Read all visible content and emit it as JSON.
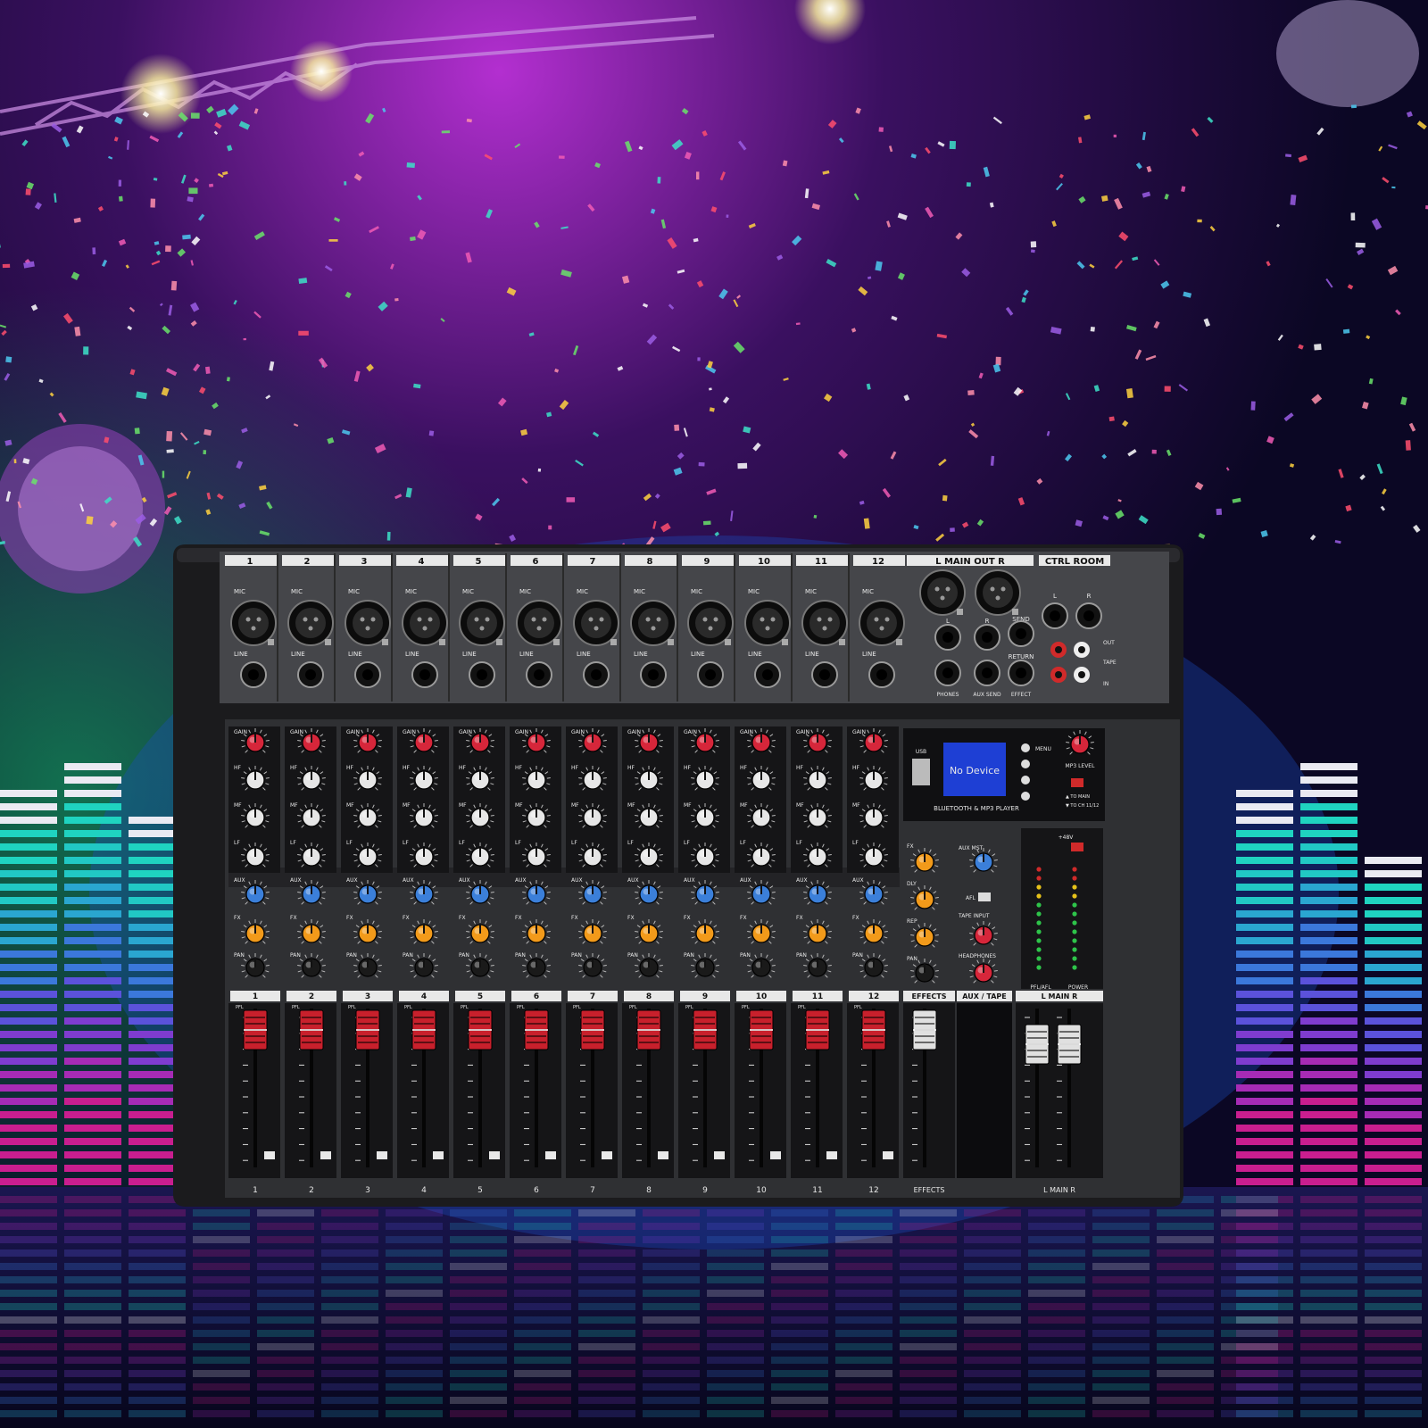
{
  "channels": [
    "1",
    "2",
    "3",
    "4",
    "5",
    "6",
    "7",
    "8",
    "9",
    "10",
    "11",
    "12"
  ],
  "strip_labels": {
    "mic": "MIC",
    "line": "LINE",
    "gain": "GAIN",
    "hf": "HF",
    "mf": "MF",
    "lf": "LF",
    "aux": "AUX",
    "fx": "FX",
    "pan": "PAN",
    "pfl": "PFL"
  },
  "rear_panel": {
    "main_out": "L  MAIN OUT  R",
    "ctrl_room": "CTRL ROOM",
    "l": "L",
    "r": "R",
    "phones": "PHONES",
    "aux_send": "AUX SEND",
    "send": "SEND",
    "return": "RETURN",
    "effect": "EFFECT",
    "out": "OUT",
    "tape": "TAPE",
    "in": "IN"
  },
  "player": {
    "usb": "USB",
    "display": "No Device",
    "title": "BLUETOOTH & MP3 PLAYER",
    "menu": "MENU",
    "mp3_level": "MP3 LEVEL",
    "to_main": "▲ TO MAIN",
    "to_ch": "▼ TO CH 11/12"
  },
  "master_section": {
    "fx": "FX",
    "dly": "DLY",
    "rep": "REP",
    "pan": "PAN",
    "aux_mst": "AUX MST",
    "afl": "AFL",
    "tape_input": "TAPE INPUT",
    "headphones": "HEADPHONES",
    "phantom": "+48V",
    "pfl_afl": "PFL/AFL",
    "power": "POWER",
    "effects": "EFFECTS",
    "aux_tape": "AUX / TAPE",
    "main_lr": "L  MAIN  R"
  },
  "colors": {
    "gain_knob": "#d6263a",
    "eq_knob": "#e6e6e6",
    "aux_knob": "#3b7fd9",
    "fx_knob": "#f29a1a",
    "pan_knob": "#1a1a1a",
    "fader_cap": "#c8202c"
  }
}
